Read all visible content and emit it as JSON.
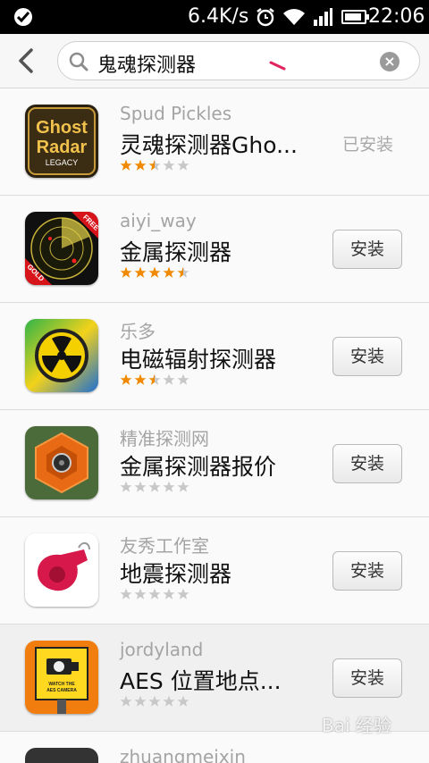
{
  "status_bar": {
    "network_speed": "6.4K/s",
    "time": "22:06",
    "battery_level": 0.9
  },
  "search": {
    "query": "鬼魂探测器"
  },
  "results": [
    {
      "developer": "Spud Pickles",
      "name": "灵魂探测器Gho...",
      "rating": 2.5,
      "action": "已安装",
      "installed": true,
      "icon": "ghost-radar-icon"
    },
    {
      "developer": "aiyi_way",
      "name": "金属探测器",
      "rating": 4.5,
      "action": "安装",
      "installed": false,
      "icon": "radar-gold-icon"
    },
    {
      "developer": "乐多",
      "name": "电磁辐射探测器",
      "rating": 2.5,
      "action": "安装",
      "installed": false,
      "icon": "radiation-icon"
    },
    {
      "developer": "精准探测网",
      "name": "金属探测器报价",
      "rating": 0,
      "action": "安装",
      "installed": false,
      "icon": "orange-hex-icon"
    },
    {
      "developer": "友秀工作室",
      "name": "地震探测器",
      "rating": 0,
      "action": "安装",
      "installed": false,
      "icon": "whistle-icon"
    },
    {
      "developer": "jordyland",
      "name": "AES 位置地点...",
      "rating": 0,
      "action": "安装",
      "installed": false,
      "icon": "camera-sign-icon"
    }
  ],
  "partial_row": {
    "developer": "zhuangmeixin"
  },
  "icon_text": {
    "ghost_radar_line1": "Ghost",
    "ghost_radar_line2": "Radar",
    "ghost_radar_line3": "LEGACY",
    "radar_badge_free": "FREE",
    "radar_badge_gold": "GOLD",
    "camera_sign_line1": "WATCH THE",
    "camera_sign_line2": "AES CAMERA"
  },
  "watermark": "Bai 经验",
  "colors": {
    "star_filled": "#f08a00",
    "star_empty": "#c8c8c8",
    "status_bar": "#000000"
  }
}
